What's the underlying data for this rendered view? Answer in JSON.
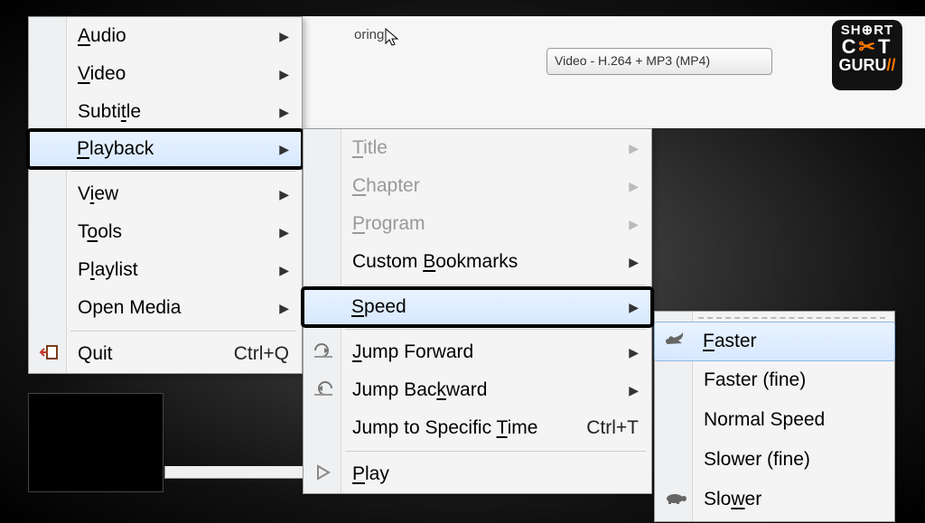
{
  "partial_text": "oring",
  "dropdown_value": "Video - H.264 + MP3 (MP4)",
  "logo": {
    "line1": "SH⊕RT",
    "line2_a": "C",
    "line2_b": "T",
    "line3_a": "GURU",
    "line3_b": "//"
  },
  "menu1": {
    "audio": {
      "label": "Audio",
      "u": "A"
    },
    "video": {
      "label": "Video",
      "u": "V"
    },
    "subtitle": {
      "label": "Subtitle",
      "u": "t"
    },
    "playback": {
      "label": "Playback",
      "u": "P"
    },
    "view": {
      "label": "View",
      "u": "i"
    },
    "tools": {
      "label": "Tools",
      "u": "o"
    },
    "playlist": {
      "label": "Playlist",
      "u": "l"
    },
    "openmedia": {
      "label": "Open Media"
    },
    "quit": {
      "label": "Quit",
      "shortcut": "Ctrl+Q"
    }
  },
  "menu2": {
    "title": {
      "label": "Title",
      "u": "T"
    },
    "chapter": {
      "label": "Chapter",
      "u": "C"
    },
    "program": {
      "label": "Program",
      "u": "P"
    },
    "bookmarks": {
      "label_a": "Custom ",
      "label_b": "Bookmarks",
      "u": "B"
    },
    "speed": {
      "label": "Speed",
      "u": "S"
    },
    "jumpfwd": {
      "label_a": "Jump Forward",
      "u": "J"
    },
    "jumpback": {
      "label_a": "Jump Bac",
      "label_b": "kward",
      "u": "k"
    },
    "jumptime": {
      "label_a": "Jump to Specific ",
      "label_b": "Time",
      "u": "T",
      "shortcut": "Ctrl+T"
    },
    "play": {
      "label": "Play",
      "u": "P"
    }
  },
  "menu3": {
    "faster": {
      "label": "Faster",
      "u": "F"
    },
    "fasterfine": {
      "label": "Faster (fine)"
    },
    "normal": {
      "label": "Normal Speed"
    },
    "slowerfine": {
      "label": "Slower (fine)"
    },
    "slower": {
      "label_a": "Slo",
      "label_b": "wer",
      "u": "w"
    }
  }
}
